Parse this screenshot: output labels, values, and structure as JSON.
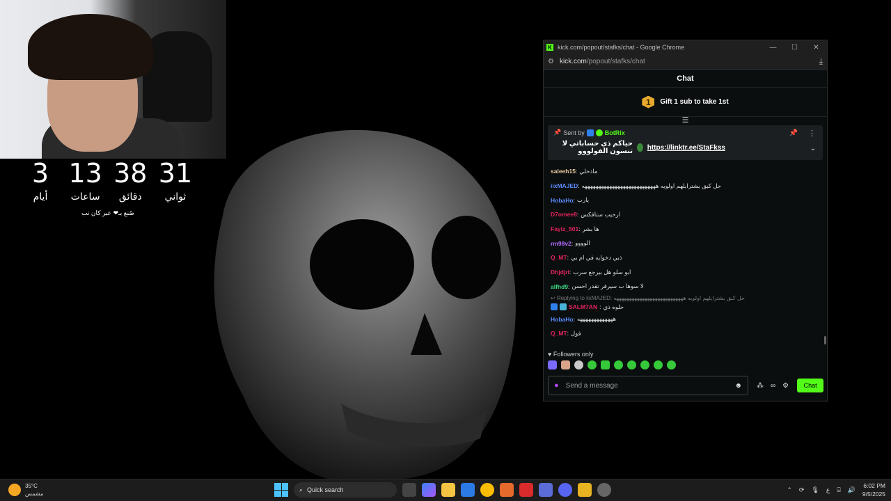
{
  "countdown": [
    {
      "value": "3",
      "unit": "أيام"
    },
    {
      "value": "13",
      "unit": "ساعات"
    },
    {
      "value": "38",
      "unit": "دقائق"
    },
    {
      "value": "31",
      "unit": "ثواني"
    }
  ],
  "countdown_credit": "صُنع بـ❤ عبر كان تب",
  "window": {
    "title": "kick.com/popout/stafks/chat - Google Chrome",
    "url_host": "kick.com",
    "url_path": "/popout/stafks/chat"
  },
  "chat": {
    "header": "Chat",
    "gift_badge": "1",
    "gift_text": "Gift 1 sub to take 1st",
    "pinned": {
      "sent_by": "Sent by",
      "bot_name": "BotRix",
      "link": "https://linktr.ee/StaFkss",
      "text": "حياكم ذي حساباتي لا تنسون الفولووو"
    },
    "messages": [
      {
        "user": "saleeh15",
        "color": "#e8c8a0",
        "text": "ماذخلي"
      },
      {
        "user": "iixMAJED",
        "color": "#5b8cff",
        "text": "حل كبق بشترايلهم اولويه هههههههههههههههههههههههههههه"
      },
      {
        "user": "HobaHo",
        "color": "#5b8cff",
        "text": "يارب"
      },
      {
        "user": "D7omee8",
        "color": "#e0245e",
        "text": "ارحيب ستافكس"
      },
      {
        "user": "Fayiz_501",
        "color": "#e0245e",
        "text": "ها بشر"
      },
      {
        "user": "rm98v2",
        "color": "#b46cff",
        "text": "الوووو"
      },
      {
        "user": "Q_MT",
        "color": "#e0245e",
        "text": "ذبي دخوايه في ام بي"
      },
      {
        "user": "Dhjdjrl",
        "color": "#e0245e",
        "text": "ابو سلو هل بيرجع سرب"
      },
      {
        "user": "alfhd9",
        "color": "#3ddc84",
        "text": "لا سوها ب سيرفر تقدر احسن"
      }
    ],
    "reply": {
      "reply_label": "Replying to iixMAJED:",
      "reply_text": "حل كبق بشترايلهم اولويه هههههههههههههههههههههههههههه",
      "user": "SALM7AN",
      "color": "#e0245e",
      "text": "حلوه ذي"
    },
    "messages_after": [
      {
        "user": "HobaHo",
        "color": "#5b8cff",
        "text": "هههههههههههههه"
      },
      {
        "user": "Q_MT",
        "color": "#e0245e",
        "text": "فول"
      }
    ],
    "followers_only": "Followers only",
    "input_placeholder": "Send a message",
    "send_label": "Chat",
    "colors": {
      "accent": "#53fc18",
      "background": "#0b0e0f"
    }
  },
  "taskbar": {
    "temperature": "35°C",
    "weather": "مشمس",
    "search_label": "Quick search",
    "language": "ع",
    "time": "6:02 PM",
    "date": "9/5/2025"
  }
}
